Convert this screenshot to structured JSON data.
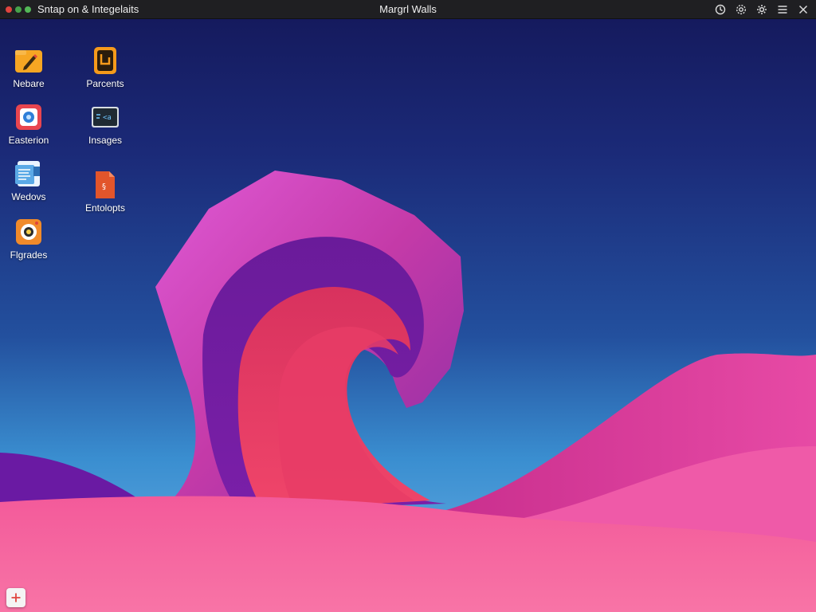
{
  "topbar": {
    "app_title": "Sntap on & Integelaits",
    "window_title": "Margrl Walls",
    "icons": [
      "clock-icon",
      "settings-alt-icon",
      "gear-icon",
      "menu-icon",
      "close-icon"
    ]
  },
  "desktop_icons": [
    {
      "label": "Nebare",
      "icon": "pencil-folder-icon",
      "color": "#f6a623"
    },
    {
      "label": "Parcents",
      "icon": "document-icon",
      "color": "#f59a1b"
    },
    {
      "label": "Easterion",
      "icon": "photo-app-icon",
      "color": "#e8454f"
    },
    {
      "label": "Insages",
      "icon": "terminal-icon",
      "color": "#1f2a33"
    },
    {
      "label": "Wedovs",
      "icon": "text-document-icon",
      "color": "#5aa9e6"
    },
    {
      "label": "Entolopts",
      "icon": "pdf-document-icon",
      "color": "#e2552b"
    },
    {
      "label": "Flgrades",
      "icon": "camera-app-icon",
      "color": "#f08a2a"
    }
  ],
  "dock": {
    "add_label": "+"
  }
}
